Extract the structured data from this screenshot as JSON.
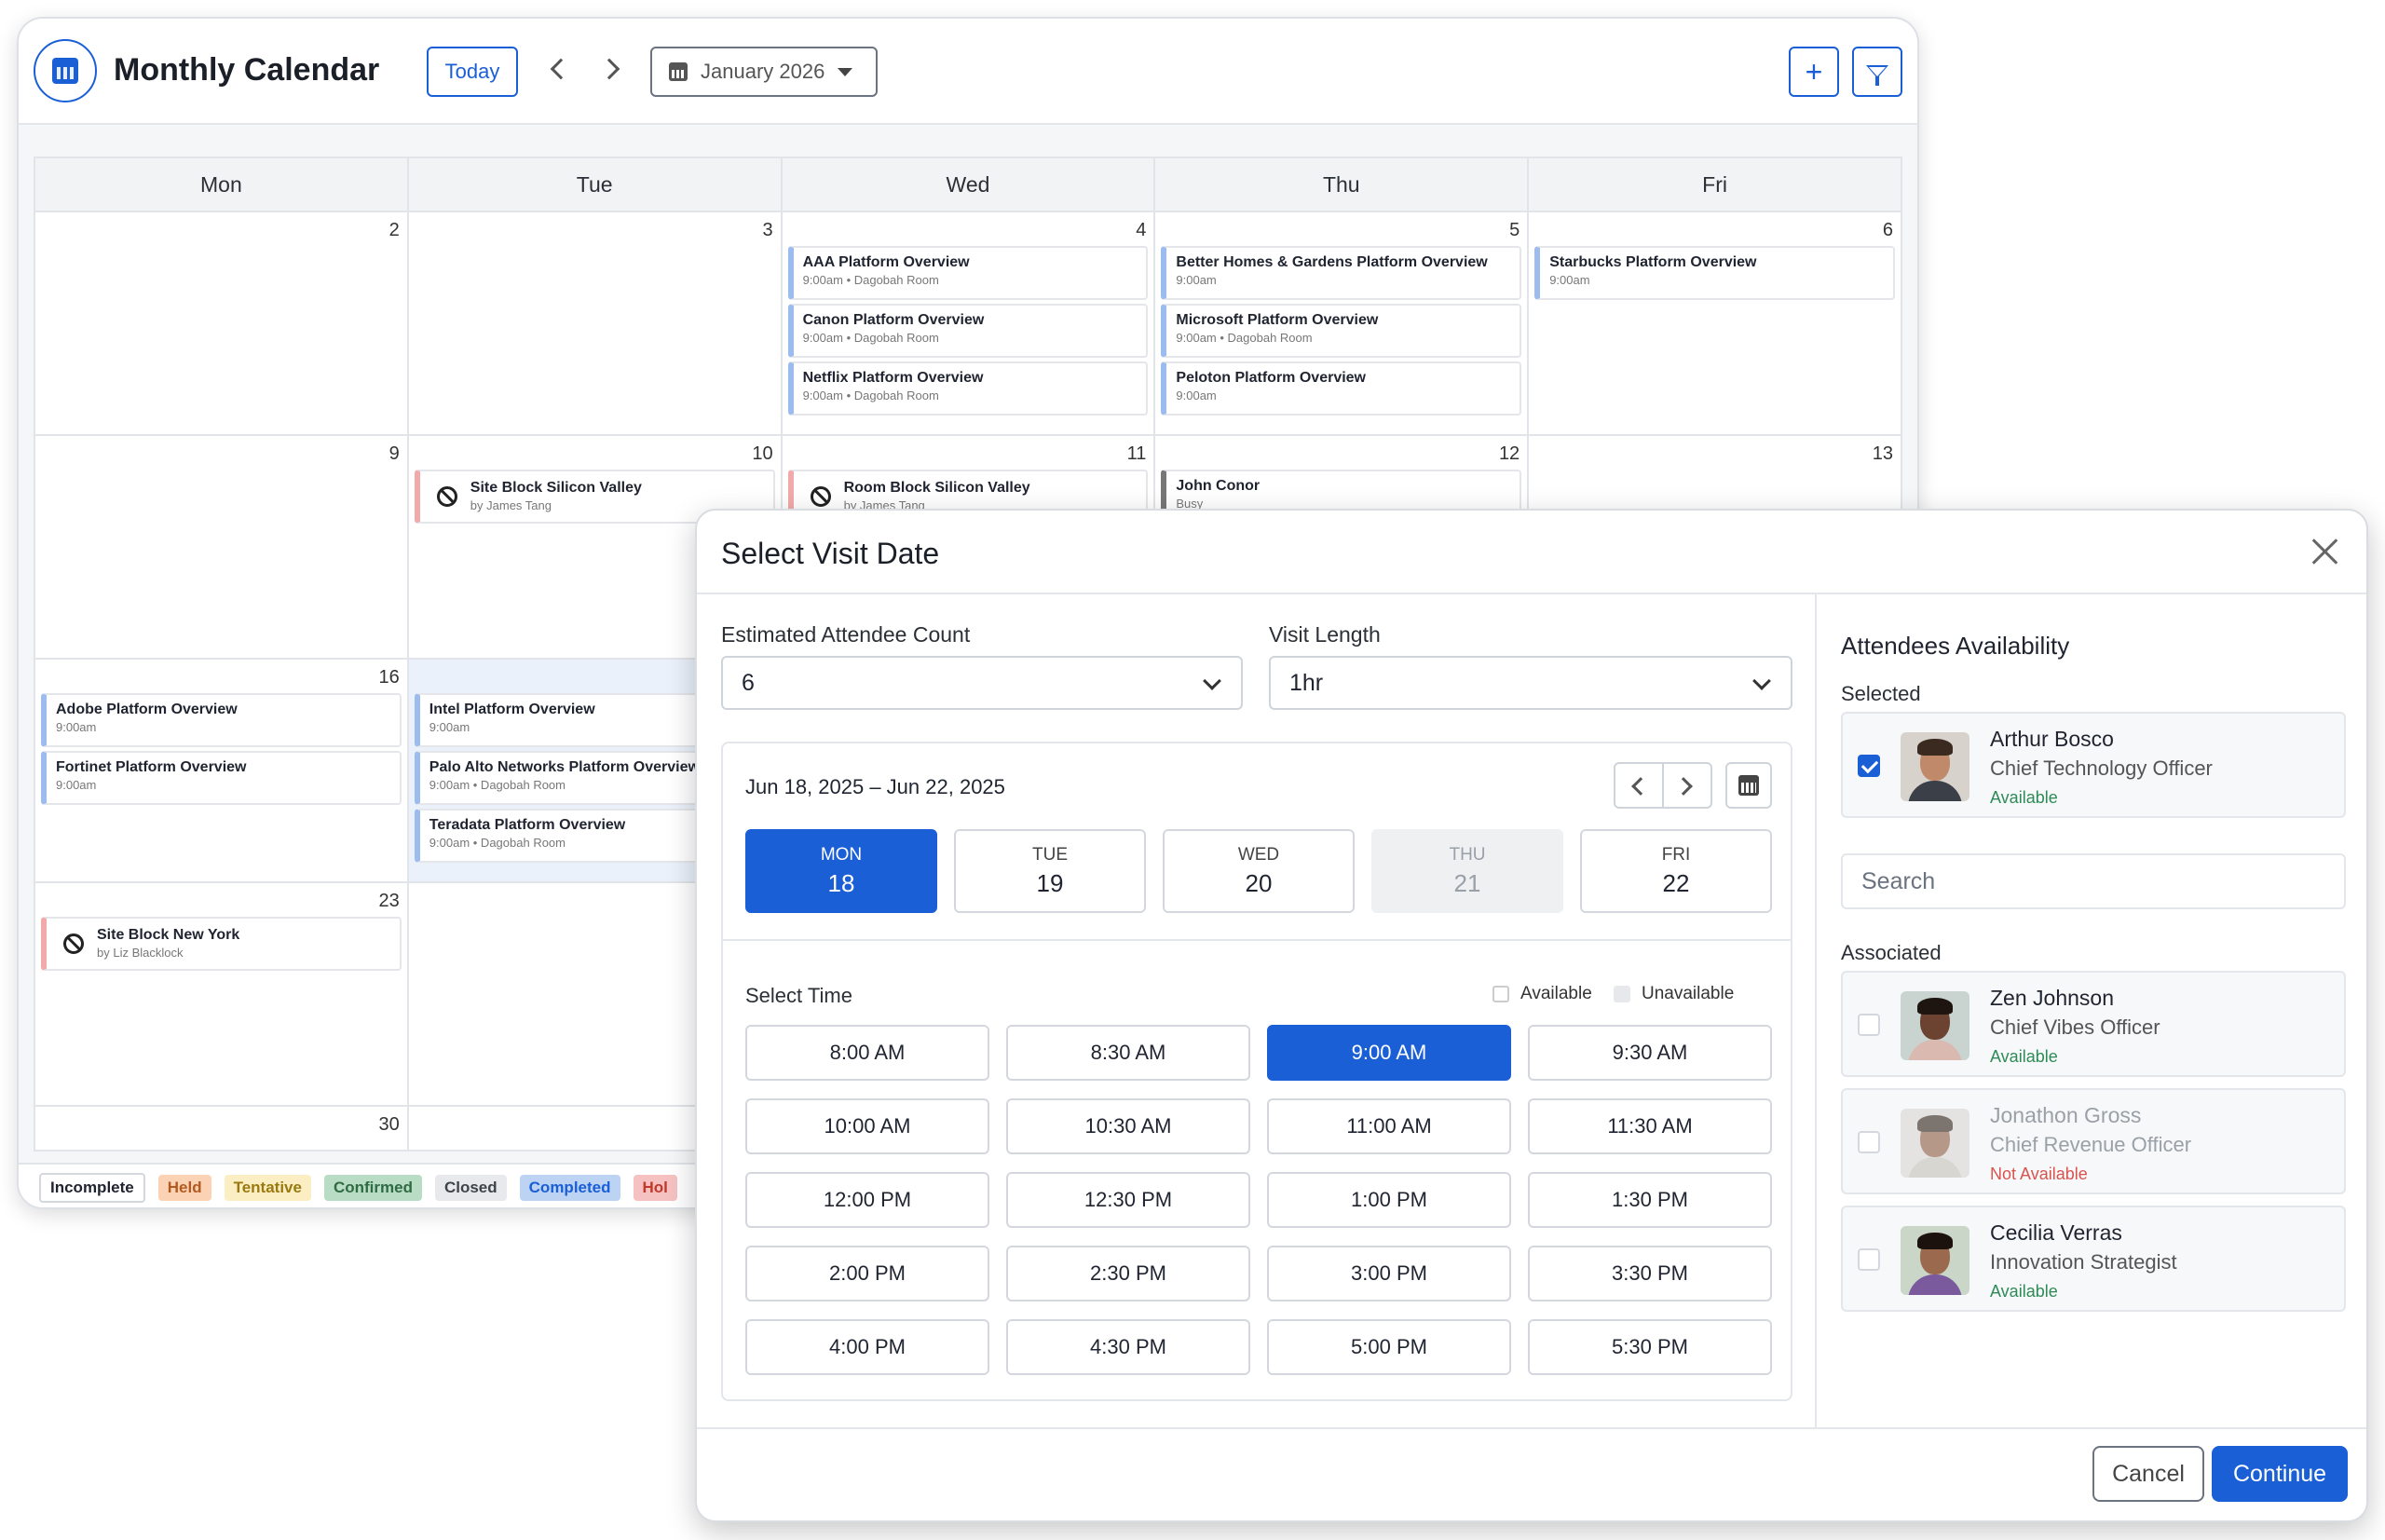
{
  "calendar": {
    "title": "Monthly Calendar",
    "today_label": "Today",
    "month_value": "January 2026",
    "day_headers": [
      "Mon",
      "Tue",
      "Wed",
      "Thu",
      "Fri"
    ],
    "weeks": [
      {
        "days": [
          {
            "num": "2",
            "events": []
          },
          {
            "num": "3",
            "events": []
          },
          {
            "num": "4",
            "events": [
              {
                "title": "AAA Platform Overview",
                "sub": "9:00am  •  Dagobah Room"
              },
              {
                "title": "Canon Platform Overview",
                "sub": "9:00am  •  Dagobah Room"
              },
              {
                "title": "Netflix Platform Overview",
                "sub": "9:00am  •  Dagobah Room"
              }
            ]
          },
          {
            "num": "5",
            "events": [
              {
                "title": "Better Homes & Gardens Platform Overview",
                "sub": "9:00am"
              },
              {
                "title": "Microsoft Platform Overview",
                "sub": "9:00am  •  Dagobah Room"
              },
              {
                "title": "Peloton Platform Overview",
                "sub": "9:00am"
              }
            ]
          },
          {
            "num": "6",
            "events": [
              {
                "title": "Starbucks Platform Overview",
                "sub": "9:00am"
              }
            ]
          }
        ]
      },
      {
        "days": [
          {
            "num": "9",
            "events": []
          },
          {
            "num": "10",
            "events": [
              {
                "title": "Site Block Silicon Valley",
                "sub": "by James Tang",
                "type": "block"
              }
            ]
          },
          {
            "num": "11",
            "events": [
              {
                "title": "Room Block Silicon Valley",
                "sub": "by James Tang",
                "type": "block"
              }
            ]
          },
          {
            "num": "12",
            "events": [
              {
                "title": "John Conor",
                "sub": "Busy",
                "type": "gray"
              }
            ]
          },
          {
            "num": "13",
            "events": []
          }
        ]
      },
      {
        "days": [
          {
            "num": "16",
            "events": [
              {
                "title": "Adobe Platform Overview",
                "sub": "9:00am"
              },
              {
                "title": "Fortinet Platform Overview",
                "sub": "9:00am"
              }
            ]
          },
          {
            "num": "",
            "highlight": true,
            "events": [
              {
                "title": "Intel Platform Overview",
                "sub": "9:00am"
              },
              {
                "title": "Palo Alto Networks Platform Overview",
                "sub": "9:00am  •  Dagobah Room"
              },
              {
                "title": "Teradata Platform Overview",
                "sub": "9:00am  •  Dagobah Room"
              }
            ]
          },
          {
            "num": "",
            "events": []
          },
          {
            "num": "",
            "events": []
          },
          {
            "num": "",
            "events": []
          }
        ]
      },
      {
        "days": [
          {
            "num": "23",
            "events": [
              {
                "title": "Site Block New York",
                "sub": "by Liz Blacklock",
                "type": "block"
              }
            ]
          },
          {
            "num": "",
            "events": []
          },
          {
            "num": "",
            "events": []
          },
          {
            "num": "",
            "events": []
          },
          {
            "num": "",
            "events": []
          }
        ]
      },
      {
        "days": [
          {
            "num": "30",
            "events": []
          },
          {
            "num": "",
            "events": []
          },
          {
            "num": "",
            "events": []
          },
          {
            "num": "",
            "events": []
          },
          {
            "num": "",
            "events": []
          }
        ]
      }
    ],
    "legend": [
      {
        "label": "Incomplete",
        "bg": "#ffffff",
        "fg": "#1f2430",
        "border": "#d4d8de"
      },
      {
        "label": "Held",
        "bg": "#fbd3b4",
        "fg": "#b35a1f"
      },
      {
        "label": "Tentative",
        "bg": "#fbeec2",
        "fg": "#9a7a10"
      },
      {
        "label": "Confirmed",
        "bg": "#b9dcc4",
        "fg": "#2f6b43"
      },
      {
        "label": "Closed",
        "bg": "#e7e9ec",
        "fg": "#3f444b"
      },
      {
        "label": "Completed",
        "bg": "#bcd3f3",
        "fg": "#1a5fd6"
      },
      {
        "label": "Hol",
        "bg": "#f6c1c1",
        "fg": "#c0392b"
      }
    ]
  },
  "modal": {
    "title": "Select Visit Date",
    "attendee_count_label": "Estimated Attendee Count",
    "attendee_count_value": "6",
    "visit_length_label": "Visit Length",
    "visit_length_value": "1hr",
    "date_range": "Jun 18, 2025 – Jun 22, 2025",
    "days": [
      {
        "dow": "MON",
        "num": "18",
        "state": "selected"
      },
      {
        "dow": "TUE",
        "num": "19",
        "state": "normal"
      },
      {
        "dow": "WED",
        "num": "20",
        "state": "normal"
      },
      {
        "dow": "THU",
        "num": "21",
        "state": "disabled"
      },
      {
        "dow": "FRI",
        "num": "22",
        "state": "normal"
      }
    ],
    "select_time_label": "Select Time",
    "legend_available": "Available",
    "legend_unavailable": "Unavailable",
    "times": [
      {
        "label": "8:00 AM"
      },
      {
        "label": "8:30 AM"
      },
      {
        "label": "9:00 AM",
        "selected": true
      },
      {
        "label": "9:30 AM"
      },
      {
        "label": "10:00 AM"
      },
      {
        "label": "10:30 AM"
      },
      {
        "label": "11:00 AM"
      },
      {
        "label": "11:30 AM"
      },
      {
        "label": "12:00 PM"
      },
      {
        "label": "12:30 PM"
      },
      {
        "label": "1:00 PM"
      },
      {
        "label": "1:30 PM"
      },
      {
        "label": "2:00 PM"
      },
      {
        "label": "2:30 PM"
      },
      {
        "label": "3:00 PM"
      },
      {
        "label": "3:30 PM"
      },
      {
        "label": "4:00 PM"
      },
      {
        "label": "4:30 PM"
      },
      {
        "label": "5:00 PM"
      },
      {
        "label": "5:30 PM"
      }
    ],
    "attendees": {
      "title": "Attendees Availability",
      "selected_label": "Selected",
      "selected": [
        {
          "name": "Arthur Bosco",
          "role": "Chief Technology Officer",
          "status": "Available",
          "checked": true,
          "available": true,
          "skin": "#c08a6a",
          "hair": "#3b2a20",
          "shirt": "#3a3f48",
          "bg": "#d8d2cc"
        }
      ],
      "search_placeholder": "Search",
      "associated_label": "Associated",
      "associated": [
        {
          "name": "Zen Johnson",
          "role": "Chief Vibes Officer",
          "status": "Available",
          "checked": false,
          "available": true,
          "skin": "#6b4330",
          "hair": "#1f1510",
          "shirt": "#d9b9b0",
          "bg": "#c9d4d0"
        },
        {
          "name": "Jonathon Gross",
          "role": "Chief Revenue Officer",
          "status": "Not Available",
          "checked": false,
          "available": false,
          "skin": "#8a5a3e",
          "hair": "#2a1d15",
          "shirt": "#c5c0b8",
          "bg": "#d8d6d2"
        },
        {
          "name": "Cecilia Verras",
          "role": "Innovation Strategist",
          "status": "Available",
          "checked": false,
          "available": true,
          "skin": "#9b6a4e",
          "hair": "#1b120d",
          "shirt": "#7a5a9c",
          "bg": "#c9d6c8"
        }
      ]
    },
    "cancel_label": "Cancel",
    "continue_label": "Continue"
  }
}
